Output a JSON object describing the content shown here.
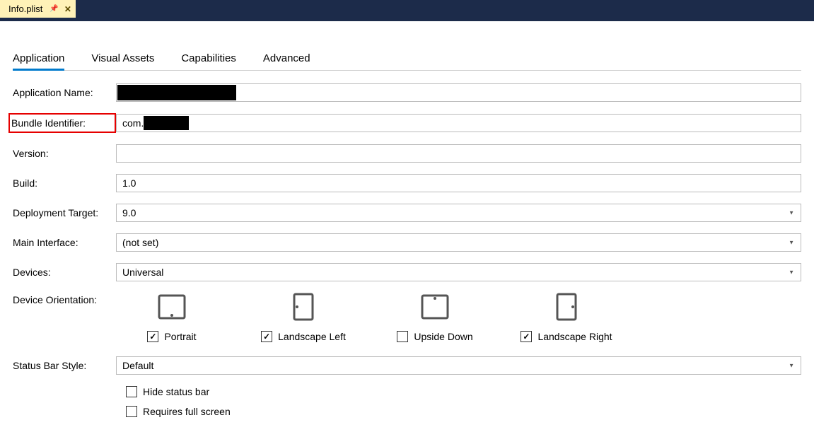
{
  "tab": {
    "title": "Info.plist"
  },
  "nav": {
    "application": "Application",
    "visual_assets": "Visual Assets",
    "capabilities": "Capabilities",
    "advanced": "Advanced"
  },
  "form": {
    "app_name_label": "Application Name:",
    "app_name_value": "",
    "bundle_id_label": "Bundle Identifier:",
    "bundle_id_prefix": "com.",
    "version_label": "Version:",
    "version_value": "",
    "build_label": "Build:",
    "build_value": "1.0",
    "deployment_label": "Deployment Target:",
    "deployment_value": "9.0",
    "main_interface_label": "Main Interface:",
    "main_interface_value": "(not set)",
    "devices_label": "Devices:",
    "devices_value": "Universal",
    "orientation_label": "Device Orientation:",
    "orientations": {
      "portrait": "Portrait",
      "landscape_left": "Landscape Left",
      "upside_down": "Upside Down",
      "landscape_right": "Landscape Right"
    },
    "status_bar_label": "Status Bar Style:",
    "status_bar_value": "Default",
    "hide_status_bar": "Hide status bar",
    "requires_full_screen": "Requires full screen"
  }
}
